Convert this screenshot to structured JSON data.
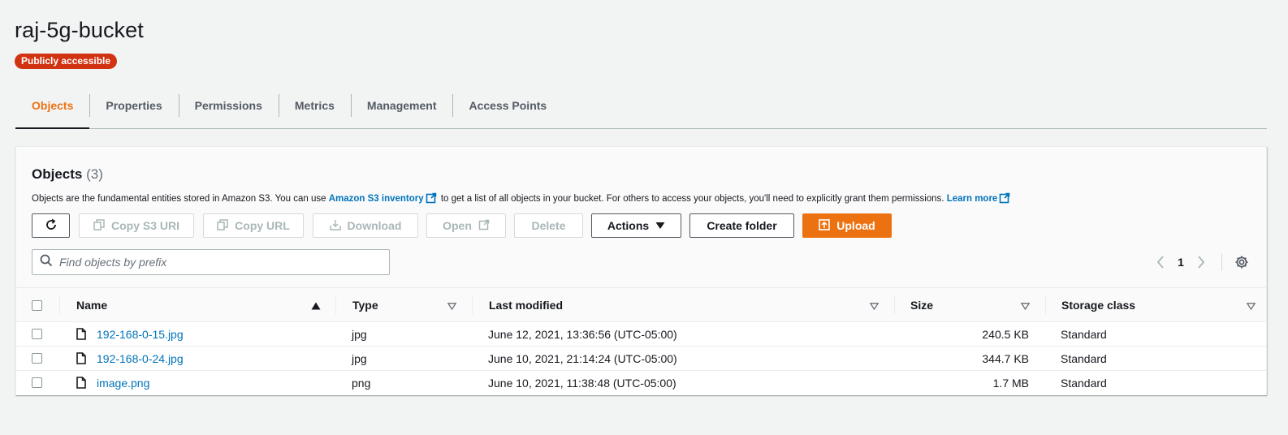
{
  "bucket": {
    "title": "raj-5g-bucket",
    "badge": "Publicly accessible"
  },
  "tabs": [
    {
      "label": "Objects",
      "active": true
    },
    {
      "label": "Properties"
    },
    {
      "label": "Permissions"
    },
    {
      "label": "Metrics"
    },
    {
      "label": "Management"
    },
    {
      "label": "Access Points"
    }
  ],
  "objects": {
    "title": "Objects",
    "count": "(3)",
    "desc_part1": "Objects are the fundamental entities stored in Amazon S3. You can use ",
    "desc_link1": "Amazon S3 inventory",
    "desc_part2": " to get a list of all objects in your bucket. For others to access your objects, you'll need to explicitly grant them permissions. ",
    "desc_link2": "Learn more"
  },
  "toolbar": {
    "copy_s3_uri": "Copy S3 URI",
    "copy_url": "Copy URL",
    "download": "Download",
    "open": "Open",
    "delete": "Delete",
    "actions": "Actions",
    "create_folder": "Create folder",
    "upload": "Upload"
  },
  "search": {
    "placeholder": "Find objects by prefix",
    "value": ""
  },
  "pagination": {
    "page": "1"
  },
  "table": {
    "columns": {
      "name": "Name",
      "type": "Type",
      "last_modified": "Last modified",
      "size": "Size",
      "storage_class": "Storage class"
    },
    "rows": [
      {
        "name": "192-168-0-15.jpg",
        "type": "jpg",
        "last_modified": "June 12, 2021, 13:36:56 (UTC-05:00)",
        "size": "240.5 KB",
        "storage_class": "Standard"
      },
      {
        "name": "192-168-0-24.jpg",
        "type": "jpg",
        "last_modified": "June 10, 2021, 21:14:24 (UTC-05:00)",
        "size": "344.7 KB",
        "storage_class": "Standard"
      },
      {
        "name": "image.png",
        "type": "png",
        "last_modified": "June 10, 2021, 11:38:48 (UTC-05:00)",
        "size": "1.7 MB",
        "storage_class": "Standard"
      }
    ]
  },
  "colors": {
    "accent": "#ec7211",
    "link": "#0073bb",
    "badge": "#d13212",
    "text": "#16191f",
    "muted": "#687078"
  }
}
